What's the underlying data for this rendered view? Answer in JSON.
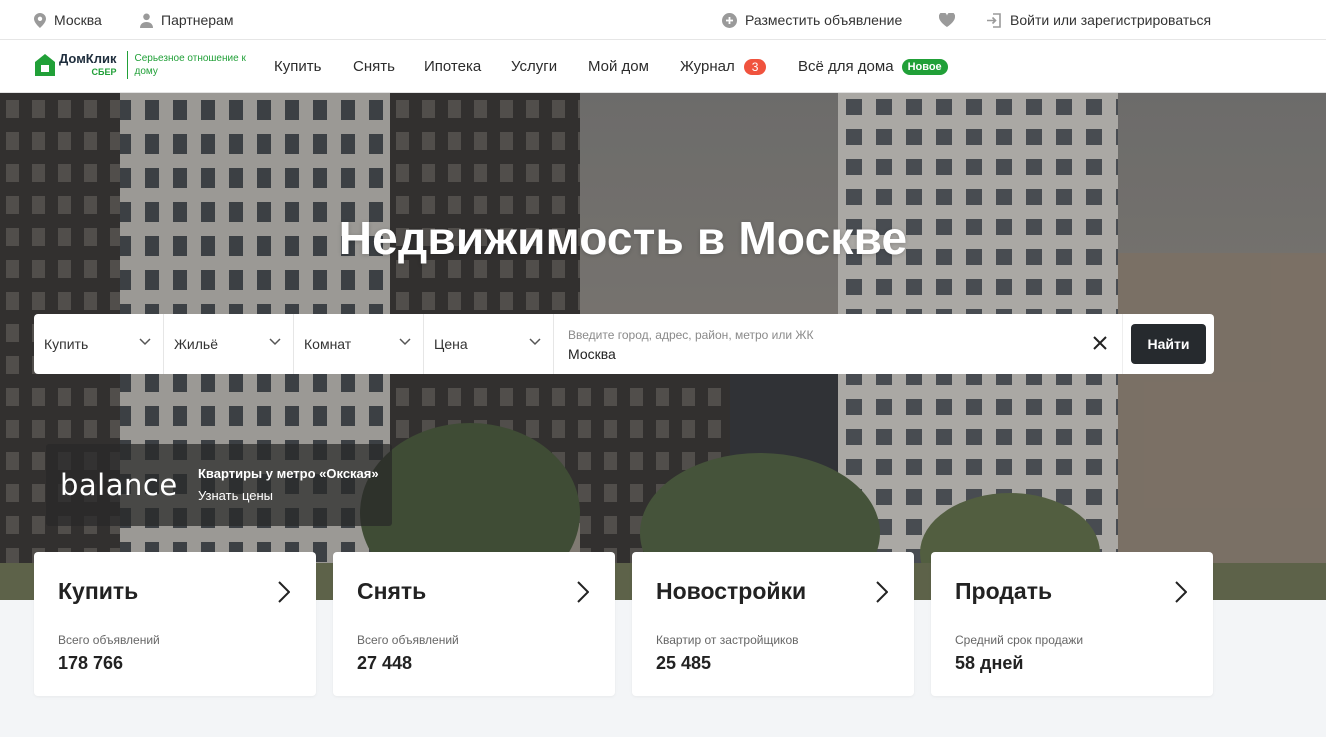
{
  "topbar": {
    "city": "Москва",
    "partners": "Партнерам",
    "place_ad": "Разместить объявление",
    "login": "Войти или зарегистрироваться"
  },
  "nav": {
    "logo_name": "ДомКлик",
    "logo_sber": "СБЕР",
    "slogan": "Серьезное отношение к дому",
    "items": [
      "Купить",
      "Снять",
      "Ипотека",
      "Услуги",
      "Мой дом",
      "Журнал",
      "Всё для дома"
    ],
    "journal_badge": "3",
    "new_badge": "Новое"
  },
  "hero": {
    "title": "Недвижимость в Москве"
  },
  "search": {
    "deal": "Купить",
    "type": "Жильё",
    "rooms": "Комнат",
    "price": "Цена",
    "placeholder": "Введите город, адрес, район, метро или ЖК",
    "value": "Москва",
    "button": "Найти"
  },
  "promo": {
    "logo": "balance",
    "line1": "Квартиры у метро «Окская»",
    "line2": "Узнать цены"
  },
  "cards": [
    {
      "title": "Купить",
      "subtitle": "Всего объявлений",
      "value": "178 766"
    },
    {
      "title": "Снять",
      "subtitle": "Всего объявлений",
      "value": "27 448"
    },
    {
      "title": "Новостройки",
      "subtitle": "Квартир от застройщиков",
      "value": "25 485"
    },
    {
      "title": "Продать",
      "subtitle": "Средний срок продажи",
      "value": "58 дней"
    }
  ],
  "colors": {
    "brand_green": "#21a038",
    "badge_red": "#f0533e",
    "button_dark": "#262a2e"
  },
  "icons": [
    "location-pin-icon",
    "person-icon",
    "plus-circle-icon",
    "heart-icon",
    "login-icon",
    "chevron-down-icon",
    "close-icon",
    "chevron-right-icon",
    "domclick-house-icon"
  ]
}
